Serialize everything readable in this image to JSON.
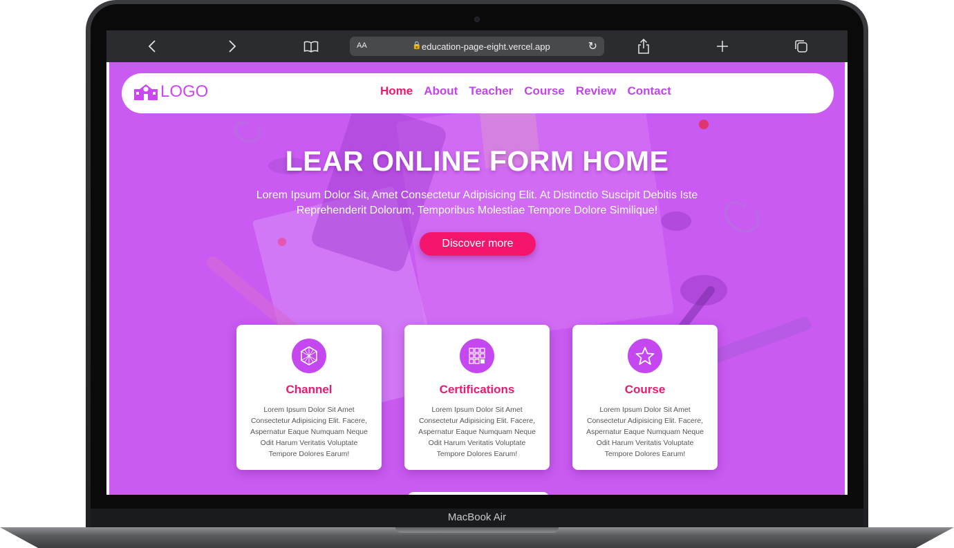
{
  "browser": {
    "text_size_label": "AA",
    "url": "education-page-eight.vercel.app"
  },
  "device": {
    "model_label": "MacBook Air"
  },
  "site": {
    "logo_text": "LOGO",
    "nav": [
      {
        "label": "Home",
        "active": true
      },
      {
        "label": "About"
      },
      {
        "label": "Teacher"
      },
      {
        "label": "Course"
      },
      {
        "label": "Review"
      },
      {
        "label": "Contact"
      }
    ],
    "hero": {
      "title": "LEAR ONLINE FORM HOME",
      "text": "Lorem Ipsum Dolor Sit, Amet Consectetur Adipisicing Elit. At Distinctio Suscipit Debitis Iste Reprehenderit Dolorum, Temporibus Molestiae Tempore Dolore Similique!",
      "button": "Discover more"
    },
    "cards": [
      {
        "icon": "hexagon-icon",
        "title": "Channel",
        "text": "Lorem Ipsum Dolor Sit Amet Consectetur Adipisicing Elit. Facere, Aspernatur Eaque Numquam Neque Odit Harum Veritatis Voluptate Tempore Dolores Earum!"
      },
      {
        "icon": "grid-icon",
        "title": "Certifications",
        "text": "Lorem Ipsum Dolor Sit Amet Consectetur Adipisicing Elit. Facere, Aspernatur Eaque Numquam Neque Odit Harum Veritatis Voluptate Tempore Dolores Earum!"
      },
      {
        "icon": "star-icon",
        "title": "Course",
        "text": "Lorem Ipsum Dolor Sit Amet Consectetur Adipisicing Elit. Facere, Aspernatur Eaque Numquam Neque Odit Harum Veritatis Voluptate Tempore Dolores Earum!"
      }
    ]
  },
  "colors": {
    "accent_purple": "#c95af2",
    "accent_pink": "#f5156d",
    "nav_purple": "#c244f0"
  }
}
